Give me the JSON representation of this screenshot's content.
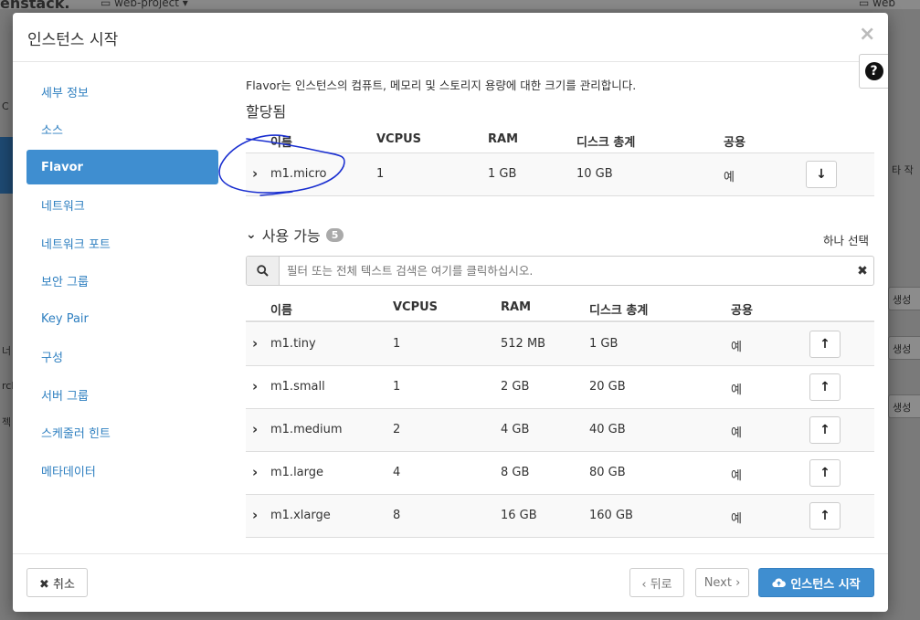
{
  "background": {
    "logo": "enstack.",
    "project": "web-project",
    "user": "web",
    "left_texts": [
      "C",
      "너",
      "rch",
      "젝"
    ],
    "right_partial": "타 작",
    "right_buttons": [
      "생성",
      "생성",
      "생성"
    ]
  },
  "modal": {
    "title": "인스턴스 시작",
    "close": "×",
    "help": "?"
  },
  "sidebar": {
    "items": [
      {
        "label": "세부 정보"
      },
      {
        "label": "소스"
      },
      {
        "label": "Flavor"
      },
      {
        "label": "네트워크"
      },
      {
        "label": "네트워크 포트"
      },
      {
        "label": "보안 그룹"
      },
      {
        "label": "Key Pair"
      },
      {
        "label": "구성"
      },
      {
        "label": "서버 그룹"
      },
      {
        "label": "스케줄러 힌트"
      },
      {
        "label": "메타데이터"
      }
    ]
  },
  "content": {
    "description": "Flavor는 인스턴스의 컴퓨트, 메모리 및 스토리지 용량에 대한 크기를 관리합니다.",
    "allocated_title": "할당됨",
    "columns": {
      "name": "이름",
      "vcpus": "VCPUS",
      "ram": "RAM",
      "disk": "디스크 총계",
      "public": "공용"
    },
    "allocated": [
      {
        "name": "m1.micro",
        "vcpus": "1",
        "ram": "1 GB",
        "disk": "10 GB",
        "public": "예"
      }
    ],
    "available_title": "사용 가능",
    "available_count": "5",
    "select_one": "하나 선택",
    "search_placeholder": "필터 또는 전체 텍스트 검색은 여기를 클릭하십시오.",
    "available": [
      {
        "name": "m1.tiny",
        "vcpus": "1",
        "ram": "512 MB",
        "disk": "1 GB",
        "public": "예"
      },
      {
        "name": "m1.small",
        "vcpus": "1",
        "ram": "2 GB",
        "disk": "20 GB",
        "public": "예"
      },
      {
        "name": "m1.medium",
        "vcpus": "2",
        "ram": "4 GB",
        "disk": "40 GB",
        "public": "예"
      },
      {
        "name": "m1.large",
        "vcpus": "4",
        "ram": "8 GB",
        "disk": "80 GB",
        "public": "예"
      },
      {
        "name": "m1.xlarge",
        "vcpus": "8",
        "ram": "16 GB",
        "disk": "160 GB",
        "public": "예"
      }
    ]
  },
  "footer": {
    "cancel": "✖ 취소",
    "back": "‹ 뒤로",
    "next": "Next ›",
    "launch": "인스턴스 시작"
  },
  "colors": {
    "accent": "#3f8ed0",
    "link": "#2e7fc0",
    "annotation": "#1a2fd0"
  }
}
